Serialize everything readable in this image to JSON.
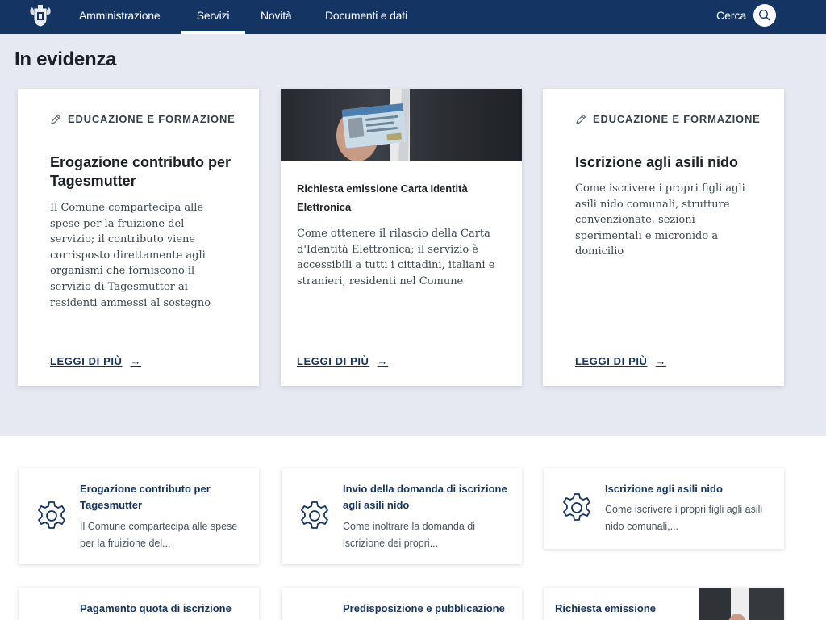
{
  "header": {
    "nav": [
      "Amministrazione",
      "Servizi",
      "Novità",
      "Documenti e dati"
    ],
    "active_nav": "Servizi",
    "search_label": "Cerca",
    "bar_color": "#143564"
  },
  "highlights": {
    "title": "In evidenza",
    "cards": [
      {
        "category": "EDUCAZIONE E FORMAZIONE",
        "title": "Erogazione contributo per Tagesmutter",
        "description": "Il Comune compartecipa alle spese per la fruizione del servizio; il contributo viene corrisposto direttamente agli organismi che forniscono il servizio di Tagesmutter ai residenti ammessi al sostegno",
        "link": "LEGGI DI PIÙ"
      },
      {
        "title": "Richiesta emissione Carta Identità Elettronica",
        "description": "Come ottenere il rilascio della Carta d'Identità Elettronica; il servizio è accessibili a tutti i cittadini, italiani e stranieri, residenti nel Comune",
        "link": "LEGGI DI PIÙ"
      },
      {
        "category": "EDUCAZIONE E FORMAZIONE",
        "title": "Iscrizione agli asili nido",
        "description": "Come iscrivere i propri figli agli asili nido comunali, strutture convenzionate, sezioni sperimentali e micronido a domicilio",
        "link": "LEGGI DI PIÙ"
      }
    ]
  },
  "services": [
    {
      "title": "Erogazione contributo per Tagesmutter",
      "description": "Il Comune compartecipa alle spese per la fruizione del..."
    },
    {
      "title": "Invio della domanda di iscrizione agli asili nido",
      "description": "Come inoltrare la domanda di iscrizione dei propri..."
    },
    {
      "title": "Iscrizione agli asili nido",
      "description": "Come iscrivere i propri figli agli asili nido comunali,..."
    },
    {
      "title": "Pagamento quota di iscrizione"
    },
    {
      "title": "Predisposizione e pubblicazione"
    },
    {
      "title": "Richiesta emissione Carta"
    }
  ]
}
